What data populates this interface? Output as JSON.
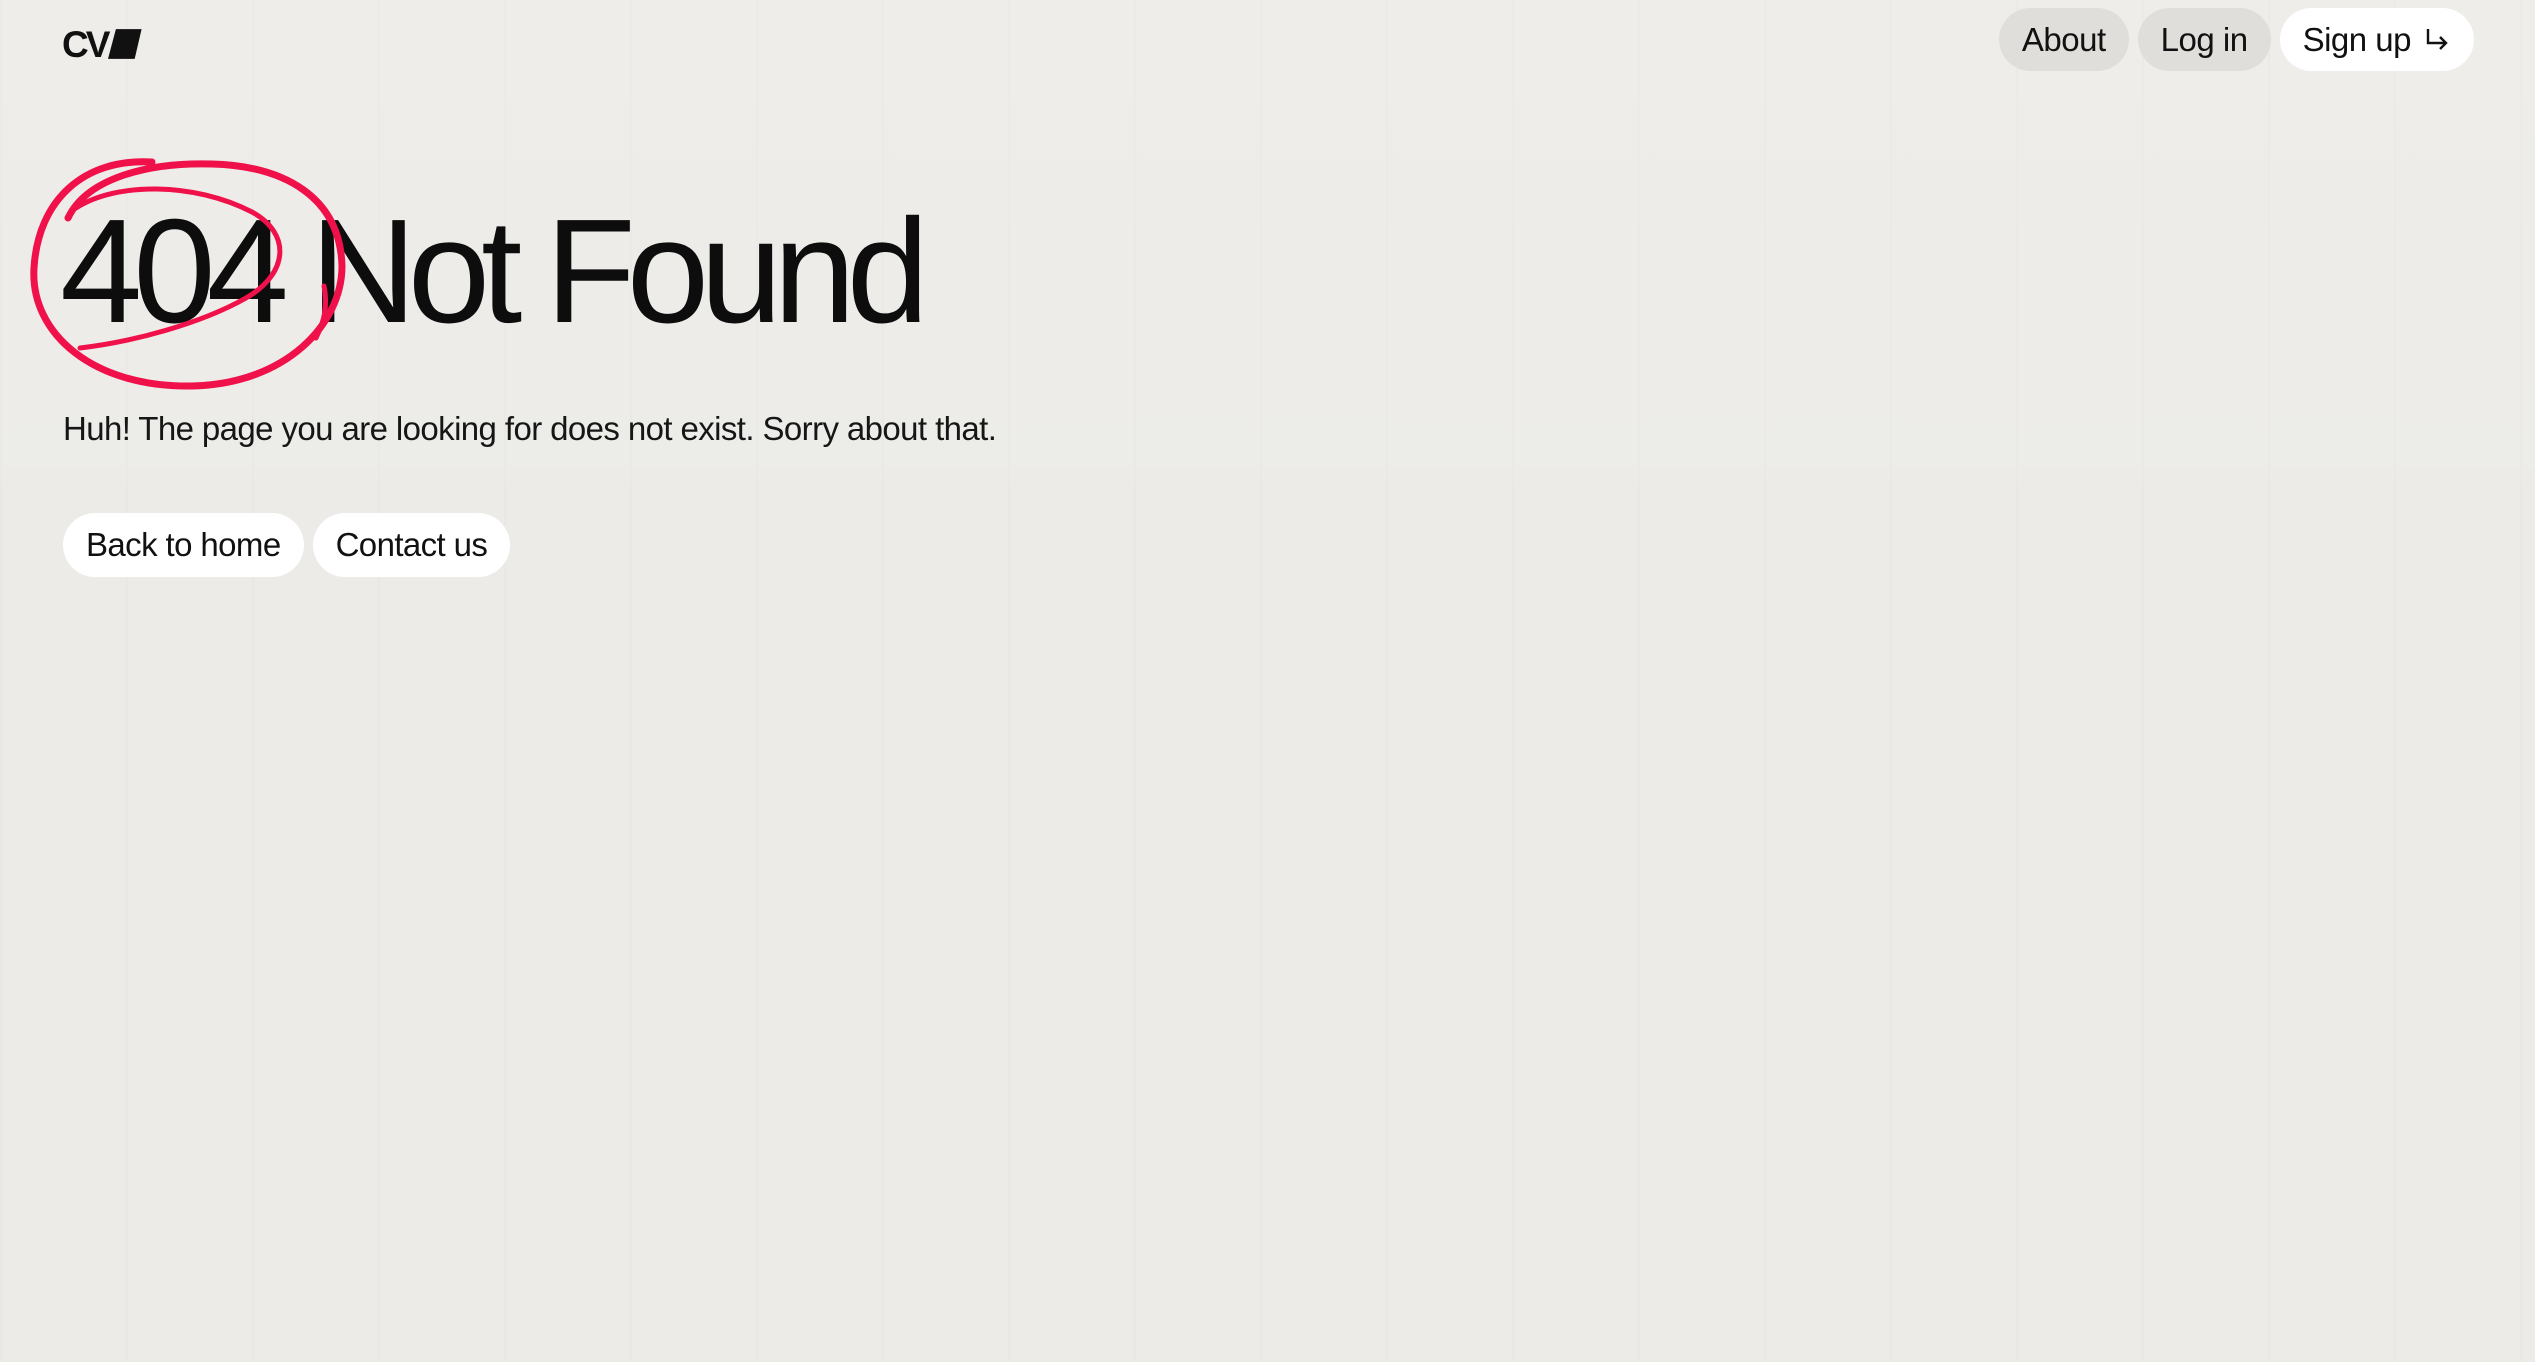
{
  "brand": {
    "logo_text": "CV",
    "logo_mark_icon": "parallelogram-mark-icon"
  },
  "nav": {
    "about_label": "About",
    "login_label": "Log in",
    "signup_label": "Sign up",
    "signup_icon": "return-arrow-icon"
  },
  "main": {
    "title_code": "404",
    "title_text": "Not Found",
    "highlight_icon": "red-circle-scribble-icon",
    "highlight_color": "#f0114b",
    "subtitle": "Huh! The page you are looking for does not exist. Sorry about that.",
    "back_home_label": "Back to home",
    "contact_label": "Contact us"
  },
  "colors": {
    "background": "#ecebe7",
    "text": "#111111",
    "button_light": "#ffffff",
    "button_muted": "#dfdedb"
  }
}
